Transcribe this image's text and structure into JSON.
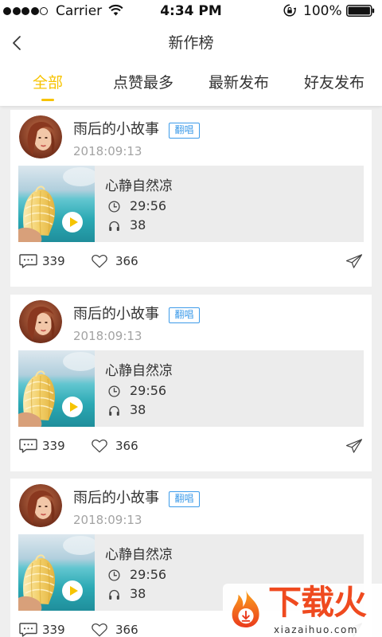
{
  "status_bar": {
    "signal_strength": 4,
    "signal_max": 5,
    "carrier": "Carrier",
    "time": "4:34 PM",
    "battery_percent": "100%",
    "battery_level": 1.0,
    "icons": {
      "wifi": "wifi-icon",
      "orientation_lock": "rotation-lock-icon",
      "battery": "battery-icon"
    }
  },
  "nav": {
    "title": "新作榜",
    "back_icon": "chevron-left-icon"
  },
  "tabs": [
    {
      "label": "全部",
      "active": true
    },
    {
      "label": "点赞最多",
      "active": false
    },
    {
      "label": "最新发布",
      "active": false
    },
    {
      "label": "好友发布",
      "active": false
    }
  ],
  "colors": {
    "accent": "#f7c300",
    "badge_blue": "#3d9be9",
    "page_background": "#efefef",
    "card_background": "#ffffff",
    "media_background": "#ececec",
    "text_primary": "#333333",
    "text_secondary": "#a3a3a3",
    "watermark_red": "#ef4a1f"
  },
  "post_icons": {
    "play": "play-icon",
    "duration": "clock-icon",
    "listens": "headphone-icon",
    "comments": "comment-icon",
    "likes": "heart-icon",
    "share": "share-icon"
  },
  "posts": [
    {
      "author": "雨后的小故事",
      "badge": "翻唱",
      "date": "2018:09:13",
      "track": {
        "title": "心静自然凉",
        "duration": "29:56",
        "listens": "38"
      },
      "comments": "339",
      "likes": "366"
    },
    {
      "author": "雨后的小故事",
      "badge": "翻唱",
      "date": "2018:09:13",
      "track": {
        "title": "心静自然凉",
        "duration": "29:56",
        "listens": "38"
      },
      "comments": "339",
      "likes": "366"
    },
    {
      "author": "雨后的小故事",
      "badge": "翻唱",
      "date": "2018:09:13",
      "track": {
        "title": "心静自然凉",
        "duration": "29:56",
        "listens": "38"
      },
      "comments": "339",
      "likes": "366"
    }
  ],
  "watermark": {
    "brand": "下载火",
    "domain": "xiazaihuo.com"
  }
}
